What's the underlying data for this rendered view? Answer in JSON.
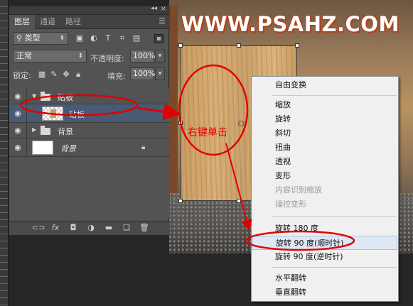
{
  "watermark": "WWW.PSAHZ.COM",
  "layers_panel": {
    "tabs": [
      "图层",
      "通道",
      "路径"
    ],
    "filter_type": "类型",
    "blend_mode": "正常",
    "opacity_label": "不透明度:",
    "opacity_value": "100%",
    "lock_label": "锁定:",
    "fill_label": "填充:",
    "fill_value": "100%",
    "layers": [
      {
        "name": "砧板",
        "kind": "group"
      },
      {
        "name": "砧板",
        "kind": "layer"
      },
      {
        "name": "背景",
        "kind": "group"
      },
      {
        "name": "背景",
        "kind": "background"
      }
    ],
    "bottom_icons": [
      "link-icon",
      "fx-icon",
      "mask-icon",
      "adjustment-icon",
      "group-icon",
      "new-layer-icon",
      "trash-icon"
    ]
  },
  "context_menu": {
    "items": [
      {
        "label": "自由变换",
        "enabled": true
      },
      {
        "label": "缩放",
        "enabled": true
      },
      {
        "label": "旋转",
        "enabled": true
      },
      {
        "label": "斜切",
        "enabled": true
      },
      {
        "label": "扭曲",
        "enabled": true
      },
      {
        "label": "透视",
        "enabled": true
      },
      {
        "label": "变形",
        "enabled": true
      },
      {
        "label": "内容识别缩放",
        "enabled": false
      },
      {
        "label": "操控变形",
        "enabled": false
      },
      {
        "label": "旋转 180 度",
        "enabled": true
      },
      {
        "label": "旋转 90 度(顺时针)",
        "enabled": true,
        "highlighted": true
      },
      {
        "label": "旋转 90 度(逆时针)",
        "enabled": true
      },
      {
        "label": "水平翻转",
        "enabled": true
      },
      {
        "label": "垂直翻转",
        "enabled": true
      }
    ]
  },
  "annotation": {
    "label": "右键单击",
    "color": "#e10000"
  },
  "colors": {
    "panel_bg": "#535353",
    "selected_layer": "#4a5a75",
    "menu_bg": "#f0f0f0",
    "annotation": "#e10000"
  }
}
